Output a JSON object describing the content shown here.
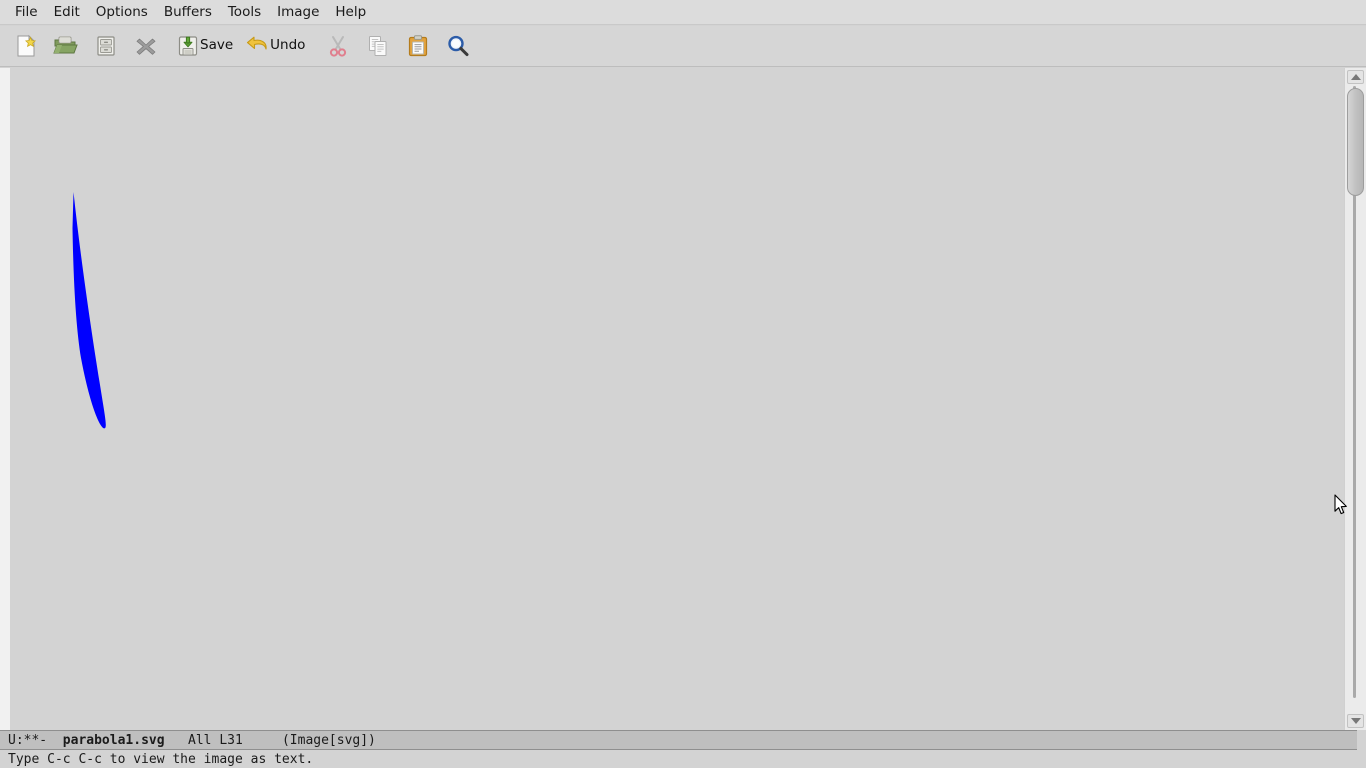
{
  "app": {
    "name": "GNU Emacs",
    "background": "#d3d3d3",
    "accent": "#0000ff"
  },
  "menubar": {
    "items": [
      {
        "label": "File",
        "name": "menu-file"
      },
      {
        "label": "Edit",
        "name": "menu-edit"
      },
      {
        "label": "Options",
        "name": "menu-options"
      },
      {
        "label": "Buffers",
        "name": "menu-buffers"
      },
      {
        "label": "Tools",
        "name": "menu-tools"
      },
      {
        "label": "Image",
        "name": "menu-image"
      },
      {
        "label": "Help",
        "name": "menu-help"
      }
    ]
  },
  "toolbar": {
    "buttons": [
      {
        "icon": "new-file-icon",
        "label": "",
        "name": "new-file-button"
      },
      {
        "icon": "open-folder-icon",
        "label": "",
        "name": "open-file-button"
      },
      {
        "icon": "dired-cabinet-icon",
        "label": "",
        "name": "open-directory-button"
      },
      {
        "icon": "close-x-icon",
        "label": "",
        "name": "close-buffer-button"
      },
      {
        "icon": "save-disk-icon",
        "label": "Save",
        "name": "save-button"
      },
      {
        "icon": "undo-arrow-icon",
        "label": "Undo",
        "name": "undo-button"
      },
      {
        "icon": "cut-scissors-icon",
        "label": "",
        "name": "cut-button"
      },
      {
        "icon": "copy-pages-icon",
        "label": "",
        "name": "copy-button"
      },
      {
        "icon": "paste-clipboard-icon",
        "label": "",
        "name": "paste-button"
      },
      {
        "icon": "search-magnifier-icon",
        "label": "",
        "name": "search-button"
      }
    ]
  },
  "buffer": {
    "image_alt": "parabola1.svg",
    "shape_color": "#0000ff",
    "canvas_background": "#d3d3d3"
  },
  "modeline": {
    "status": "U:**-",
    "buffer_name": "parabola1.svg",
    "position": "All L31",
    "major_mode": "(Image[svg])"
  },
  "minibuffer": {
    "message": "Type C-c C-c to view the image as text."
  },
  "scrollbar": {
    "up_arrow": "scrollbar-up-arrow",
    "down_arrow": "scrollbar-down-arrow"
  }
}
